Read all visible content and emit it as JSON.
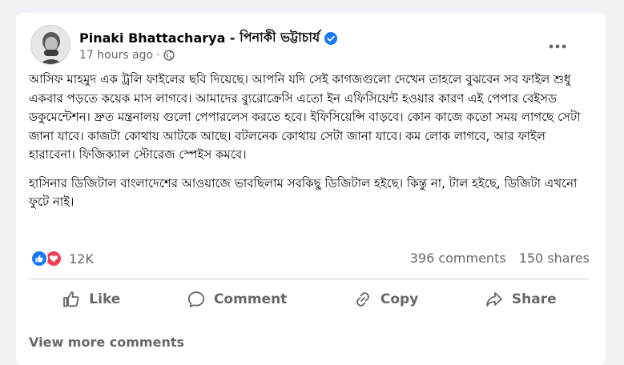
{
  "post": {
    "author_en": "Pinaki Bhattacharya",
    "separator": " - ",
    "author_bn": "পিনাকী ভট্টাচার্য",
    "timestamp": "17 hours ago",
    "dot": "·",
    "verified": true,
    "paragraphs": [
      "আসিফ মাহমুদ এক ট্রলি ফাইলের ছবি দিয়েছে। আপনি যদি সেই কাগজগুলো দেখেন তাহলে বুঝবেন সব ফাইল শুধু একবার পড়তে কয়েক মাস লাগবে। আমাদের ব্যুরোক্রেসি এতো ইন এফিসিয়েন্ট হওয়ার কারণ এই পেপার বেইসড ডকুমেন্টেশন। দ্রুত মন্ত্রনালয় গুলো পেপারলেস করতে হবে। ইফিসিয়েন্সি বাড়বে। কোন কাজে কতো সময় লাগছে সেটা জানা যাবে। কাজটা কোথায় আটকে আছে। বটলনেক কোথায় সেটা জানা যাবে। কম লোক লাগবে, আর ফাইল হারাবেনা। ফিজিক্যাল স্টোরেজ স্পেইস কমবে।",
      "হাসিনার ডিজিটাল বাংলাদেশের আওয়াজে ভাবছিলাম সবকিছু ডিজিটাল হইছে। কিন্তু না, টাল হইছে, ডিজিটা এখনো ফুটে নাই।"
    ]
  },
  "stats": {
    "reactions_count": "12K",
    "comments": "396 comments",
    "shares": "150 shares",
    "like_color": "#1877f2",
    "love_color": "#f33e58"
  },
  "actions": {
    "like": "Like",
    "comment": "Comment",
    "copy": "Copy",
    "share": "Share"
  },
  "footer": {
    "view_more": "View more comments"
  },
  "icons": {
    "avatar": "profile-photo",
    "verified": "verified-badge-icon",
    "privacy": "globe-icon",
    "more": "more-horizontal-icon"
  }
}
